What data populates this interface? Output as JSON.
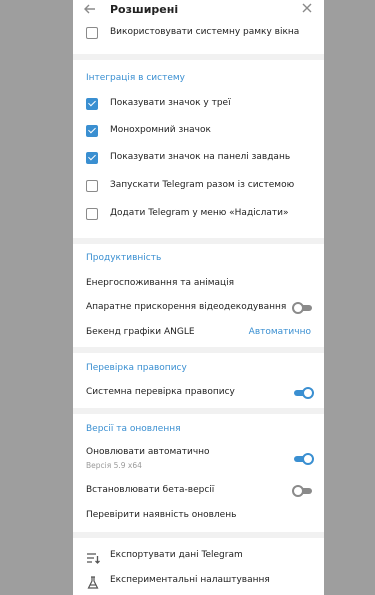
{
  "header": {
    "title": "Розширені"
  },
  "top_row": {
    "label": "Використовувати системну рамку вікна",
    "checked": false
  },
  "integration": {
    "title": "Інтеграція в систему",
    "items": [
      {
        "label": "Показувати значок у треї",
        "checked": true
      },
      {
        "label": "Монохромний значок",
        "checked": true
      },
      {
        "label": "Показувати значок на панелі завдань",
        "checked": true
      },
      {
        "label": "Запускати Telegram разом із системою",
        "checked": false
      },
      {
        "label": "Додати Telegram у меню «Надіслати»",
        "checked": false
      }
    ]
  },
  "performance": {
    "title": "Продуктивність",
    "energy": "Енергоспоживання та анімація",
    "hw_accel": {
      "label": "Апаратне прискорення відеодекодування",
      "on": false
    },
    "angle": {
      "label": "Бекенд графіки ANGLE",
      "value": "Автоматично"
    }
  },
  "spellcheck": {
    "title": "Перевірка правопису",
    "system": {
      "label": "Системна перевірка правопису",
      "on": true
    }
  },
  "versions": {
    "title": "Версії та оновлення",
    "auto_update": {
      "label": "Оновлювати автоматично",
      "version": "Версія 5.9 x64",
      "on": true
    },
    "beta": {
      "label": "Встановлювати бета-версії",
      "on": false
    },
    "check": "Перевірити наявність оновлень"
  },
  "actions": {
    "export": "Експортувати дані Telegram",
    "experimental": "Експериментальні налаштування"
  }
}
